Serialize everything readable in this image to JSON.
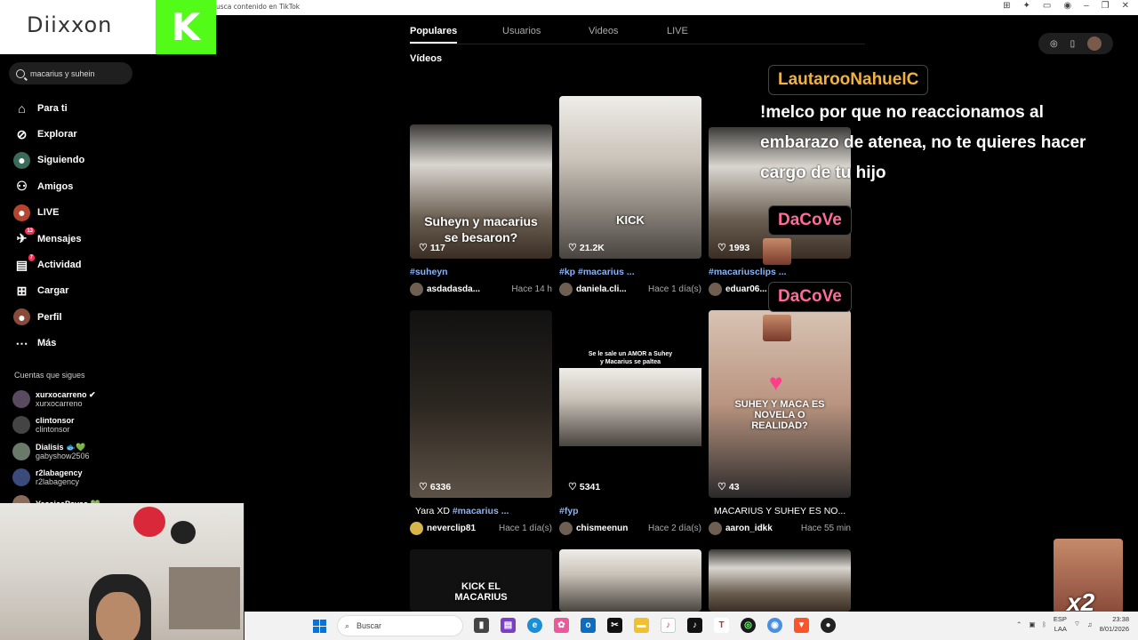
{
  "browser": {
    "address_text": "usca contenido en TikTok"
  },
  "overlay": {
    "logo_text": "Diixxon",
    "kick_letter": "K"
  },
  "sidebar": {
    "search_value": "macarius y suhein",
    "nav": [
      {
        "label": "Para ti",
        "icon": "home-icon"
      },
      {
        "label": "Explorar",
        "icon": "compass-icon"
      },
      {
        "label": "Siguiendo",
        "icon": "following-icon"
      },
      {
        "label": "Amigos",
        "icon": "friends-icon"
      },
      {
        "label": "LIVE",
        "icon": "live-icon"
      },
      {
        "label": "Mensajes",
        "icon": "messages-icon",
        "badge": "13"
      },
      {
        "label": "Actividad",
        "icon": "activity-icon",
        "badge": "7"
      },
      {
        "label": "Cargar",
        "icon": "upload-icon"
      },
      {
        "label": "Perfil",
        "icon": "profile-icon"
      },
      {
        "label": "Más",
        "icon": "more-icon"
      }
    ],
    "following_title": "Cuentas que sigues",
    "following": [
      {
        "name": "xurxocarreno ✔",
        "handle": "xurxocarreno"
      },
      {
        "name": "clintonsor",
        "handle": "clintonsor"
      },
      {
        "name": "Dialisis 🐟💚",
        "handle": "gabyshow2506"
      },
      {
        "name": "r2labagency",
        "handle": "r2labagency"
      },
      {
        "name": "YessicaPavas 💚",
        "handle": ""
      }
    ]
  },
  "tabs": [
    "Populares",
    "Usuarios",
    "Videos",
    "LIVE"
  ],
  "section_title": "Vídeos",
  "cards": [
    {
      "likes": "117",
      "tag": "#suheyn",
      "desc_rest": "",
      "user": "asdadasda...",
      "time": "Hace 14 h",
      "overlay": "Suheyn y macarius se besaron?"
    },
    {
      "likes": "21.2K",
      "tag": "#kp #macarius ...",
      "desc_rest": "",
      "user": "daniela.cli...",
      "time": "Hace 1 día(s)",
      "overlay": "KICK"
    },
    {
      "likes": "1993",
      "tag": "#macariusclips ...",
      "desc_rest": "",
      "user": "eduar06...",
      "time": "",
      "overlay": ""
    },
    {
      "likes": "6336",
      "tag": "#macarius ...",
      "desc_pre": "Yara XD ",
      "user": "neverclip81",
      "time": "Hace 1 día(s)",
      "overlay": ""
    },
    {
      "likes": "5341",
      "tag": "#fyp",
      "desc_rest": "",
      "user": "chismeenun",
      "time": "Hace 2 día(s)",
      "overlay": "Se le sale un AMOR a Suhey y Macarius se paltea"
    },
    {
      "likes": "43",
      "tag": "",
      "desc_pre": "MACARIUS Y SUHEY ES NO...",
      "user": "aaron_idkk",
      "time": "Hace 55 min",
      "overlay": "SUHEY Y MACA ES NOVELA O REALIDAD?"
    },
    {
      "overlay": "KICK EL MACARIUS"
    }
  ],
  "chat": {
    "name1": "LautarooNahuelC",
    "message": "!melco por que no reaccionamos al embarazo de atenea, no te quieres hacer cargo de tu hijo",
    "name2": "DaCoVe",
    "name3": "DaCoVe"
  },
  "stream_overlay": {
    "multiplier": "x2"
  },
  "taskbar": {
    "search_placeholder": "Buscar",
    "lang_top": "ESP",
    "lang_bottom": "LAA",
    "time": "23:38",
    "date": "8/01/2026"
  },
  "colors": {
    "kick_green": "#53fc18",
    "accent_tag": "#8ab4f8",
    "chat_name_1": "#f2b23e",
    "chat_name_2": "#ff6a9a"
  }
}
